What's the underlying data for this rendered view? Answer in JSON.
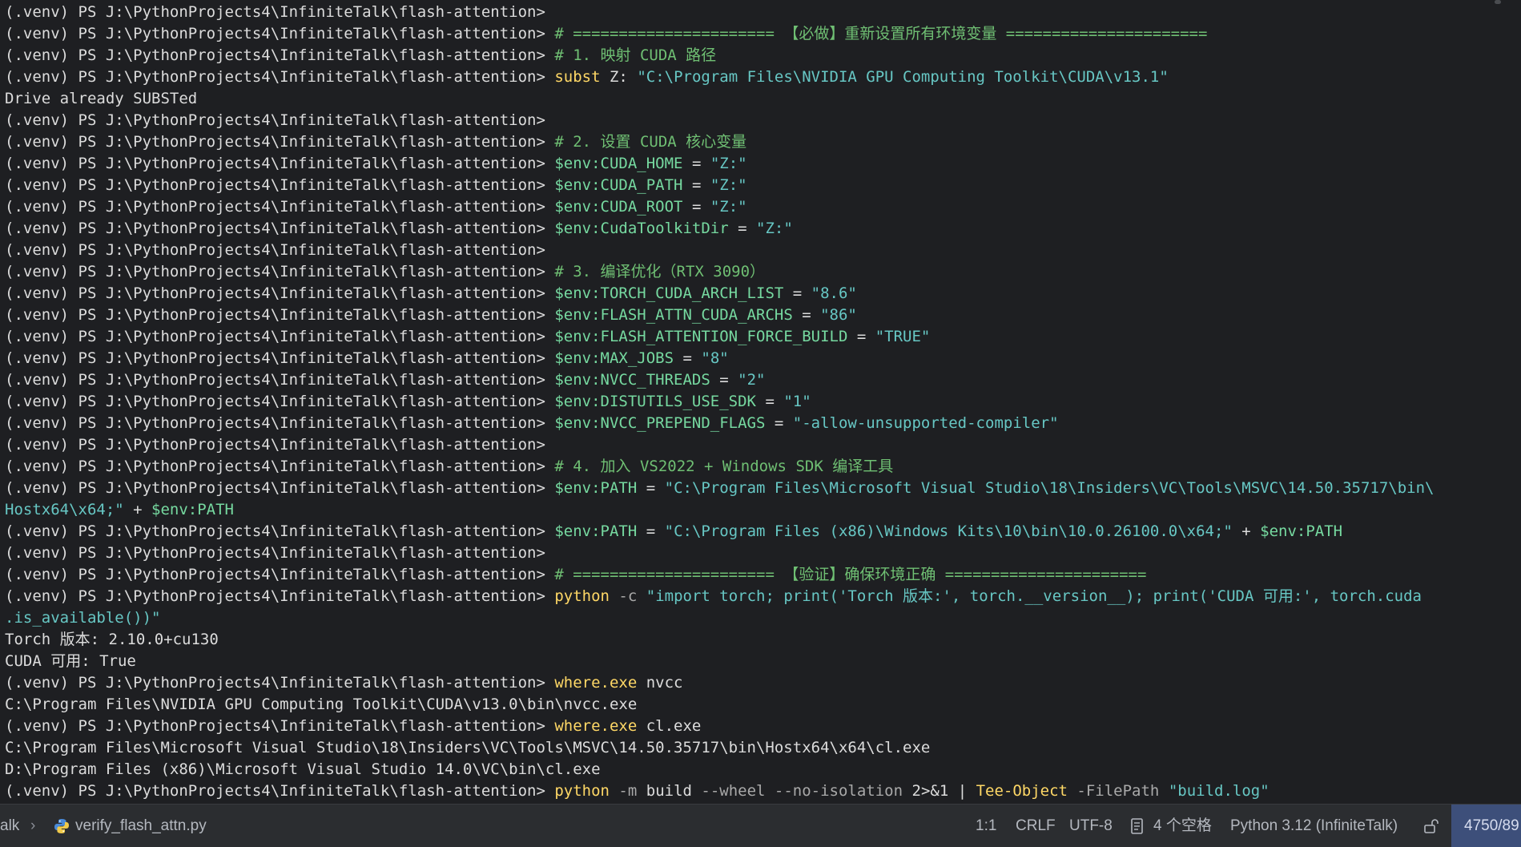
{
  "terminal": {
    "lines": [
      [
        {
          "t": "(.venv) PS J:\\PythonProjects4\\InfiniteTalk\\flash-attention> ",
          "c": "prompt"
        }
      ],
      [
        {
          "t": "(.venv) PS J:\\PythonProjects4\\InfiniteTalk\\flash-attention> ",
          "c": "prompt"
        },
        {
          "t": "# ====================== 【必做】重新设置所有环境变量 ======================",
          "c": "comment"
        }
      ],
      [
        {
          "t": "(.venv) PS J:\\PythonProjects4\\InfiniteTalk\\flash-attention> ",
          "c": "prompt"
        },
        {
          "t": "# 1. 映射 CUDA 路径",
          "c": "comment"
        }
      ],
      [
        {
          "t": "(.venv) PS J:\\PythonProjects4\\InfiniteTalk\\flash-attention> ",
          "c": "prompt"
        },
        {
          "t": "subst",
          "c": "cmd"
        },
        {
          "t": " Z: ",
          "c": "plain"
        },
        {
          "t": "\"C:\\Program Files\\NVIDIA GPU Computing Toolkit\\CUDA\\v13.1\"",
          "c": "str"
        }
      ],
      [
        {
          "t": "Drive already SUBSTed",
          "c": "out"
        }
      ],
      [
        {
          "t": "(.venv) PS J:\\PythonProjects4\\InfiniteTalk\\flash-attention> ",
          "c": "prompt"
        }
      ],
      [
        {
          "t": "(.venv) PS J:\\PythonProjects4\\InfiniteTalk\\flash-attention> ",
          "c": "prompt"
        },
        {
          "t": "# 2. 设置 CUDA 核心变量",
          "c": "comment"
        }
      ],
      [
        {
          "t": "(.venv) PS J:\\PythonProjects4\\InfiniteTalk\\flash-attention> ",
          "c": "prompt"
        },
        {
          "t": "$env:CUDA_HOME",
          "c": "var"
        },
        {
          "t": " = ",
          "c": "op"
        },
        {
          "t": "\"Z:\"",
          "c": "str"
        }
      ],
      [
        {
          "t": "(.venv) PS J:\\PythonProjects4\\InfiniteTalk\\flash-attention> ",
          "c": "prompt"
        },
        {
          "t": "$env:CUDA_PATH",
          "c": "var"
        },
        {
          "t": " = ",
          "c": "op"
        },
        {
          "t": "\"Z:\"",
          "c": "str"
        }
      ],
      [
        {
          "t": "(.venv) PS J:\\PythonProjects4\\InfiniteTalk\\flash-attention> ",
          "c": "prompt"
        },
        {
          "t": "$env:CUDA_ROOT",
          "c": "var"
        },
        {
          "t": " = ",
          "c": "op"
        },
        {
          "t": "\"Z:\"",
          "c": "str"
        }
      ],
      [
        {
          "t": "(.venv) PS J:\\PythonProjects4\\InfiniteTalk\\flash-attention> ",
          "c": "prompt"
        },
        {
          "t": "$env:CudaToolkitDir",
          "c": "var"
        },
        {
          "t": " = ",
          "c": "op"
        },
        {
          "t": "\"Z:\"",
          "c": "str"
        }
      ],
      [
        {
          "t": "(.venv) PS J:\\PythonProjects4\\InfiniteTalk\\flash-attention> ",
          "c": "prompt"
        }
      ],
      [
        {
          "t": "(.venv) PS J:\\PythonProjects4\\InfiniteTalk\\flash-attention> ",
          "c": "prompt"
        },
        {
          "t": "# 3. 编译优化（RTX 3090）",
          "c": "comment"
        }
      ],
      [
        {
          "t": "(.venv) PS J:\\PythonProjects4\\InfiniteTalk\\flash-attention> ",
          "c": "prompt"
        },
        {
          "t": "$env:TORCH_CUDA_ARCH_LIST",
          "c": "var"
        },
        {
          "t": " = ",
          "c": "op"
        },
        {
          "t": "\"8.6\"",
          "c": "str"
        }
      ],
      [
        {
          "t": "(.venv) PS J:\\PythonProjects4\\InfiniteTalk\\flash-attention> ",
          "c": "prompt"
        },
        {
          "t": "$env:FLASH_ATTN_CUDA_ARCHS",
          "c": "var"
        },
        {
          "t": " = ",
          "c": "op"
        },
        {
          "t": "\"86\"",
          "c": "str"
        }
      ],
      [
        {
          "t": "(.venv) PS J:\\PythonProjects4\\InfiniteTalk\\flash-attention> ",
          "c": "prompt"
        },
        {
          "t": "$env:FLASH_ATTENTION_FORCE_BUILD",
          "c": "var"
        },
        {
          "t": " = ",
          "c": "op"
        },
        {
          "t": "\"TRUE\"",
          "c": "str"
        }
      ],
      [
        {
          "t": "(.venv) PS J:\\PythonProjects4\\InfiniteTalk\\flash-attention> ",
          "c": "prompt"
        },
        {
          "t": "$env:MAX_JOBS",
          "c": "var"
        },
        {
          "t": " = ",
          "c": "op"
        },
        {
          "t": "\"8\"",
          "c": "str"
        }
      ],
      [
        {
          "t": "(.venv) PS J:\\PythonProjects4\\InfiniteTalk\\flash-attention> ",
          "c": "prompt"
        },
        {
          "t": "$env:NVCC_THREADS",
          "c": "var"
        },
        {
          "t": " = ",
          "c": "op"
        },
        {
          "t": "\"2\"",
          "c": "str"
        }
      ],
      [
        {
          "t": "(.venv) PS J:\\PythonProjects4\\InfiniteTalk\\flash-attention> ",
          "c": "prompt"
        },
        {
          "t": "$env:DISTUTILS_USE_SDK",
          "c": "var"
        },
        {
          "t": " = ",
          "c": "op"
        },
        {
          "t": "\"1\"",
          "c": "str"
        }
      ],
      [
        {
          "t": "(.venv) PS J:\\PythonProjects4\\InfiniteTalk\\flash-attention> ",
          "c": "prompt"
        },
        {
          "t": "$env:NVCC_PREPEND_FLAGS",
          "c": "var"
        },
        {
          "t": " = ",
          "c": "op"
        },
        {
          "t": "\"-allow-unsupported-compiler\"",
          "c": "str"
        }
      ],
      [
        {
          "t": "(.venv) PS J:\\PythonProjects4\\InfiniteTalk\\flash-attention> ",
          "c": "prompt"
        }
      ],
      [
        {
          "t": "(.venv) PS J:\\PythonProjects4\\InfiniteTalk\\flash-attention> ",
          "c": "prompt"
        },
        {
          "t": "# 4. 加入 VS2022 + Windows SDK 编译工具",
          "c": "comment"
        }
      ],
      [
        {
          "t": "(.venv) PS J:\\PythonProjects4\\InfiniteTalk\\flash-attention> ",
          "c": "prompt"
        },
        {
          "t": "$env:PATH",
          "c": "var"
        },
        {
          "t": " = ",
          "c": "op"
        },
        {
          "t": "\"C:\\Program Files\\Microsoft Visual Studio\\18\\Insiders\\VC\\Tools\\MSVC\\14.50.35717\\bin\\",
          "c": "str"
        }
      ],
      [
        {
          "t": "Hostx64\\x64;\"",
          "c": "str"
        },
        {
          "t": " + ",
          "c": "op"
        },
        {
          "t": "$env:PATH",
          "c": "var"
        }
      ],
      [
        {
          "t": "(.venv) PS J:\\PythonProjects4\\InfiniteTalk\\flash-attention> ",
          "c": "prompt"
        },
        {
          "t": "$env:PATH",
          "c": "var"
        },
        {
          "t": " = ",
          "c": "op"
        },
        {
          "t": "\"C:\\Program Files (x86)\\Windows Kits\\10\\bin\\10.0.26100.0\\x64;\"",
          "c": "str"
        },
        {
          "t": " + ",
          "c": "op"
        },
        {
          "t": "$env:PATH",
          "c": "var"
        }
      ],
      [
        {
          "t": "(.venv) PS J:\\PythonProjects4\\InfiniteTalk\\flash-attention> ",
          "c": "prompt"
        }
      ],
      [
        {
          "t": "(.venv) PS J:\\PythonProjects4\\InfiniteTalk\\flash-attention> ",
          "c": "prompt"
        },
        {
          "t": "# ====================== 【验证】确保环境正确 ======================",
          "c": "comment"
        }
      ],
      [
        {
          "t": "(.venv) PS J:\\PythonProjects4\\InfiniteTalk\\flash-attention> ",
          "c": "prompt"
        },
        {
          "t": "python",
          "c": "cmd"
        },
        {
          "t": " -c ",
          "c": "param"
        },
        {
          "t": "\"import torch; print('Torch 版本:', torch.__version__); print('CUDA 可用:', torch.cuda",
          "c": "str"
        }
      ],
      [
        {
          "t": ".is_available())\"",
          "c": "str"
        }
      ],
      [
        {
          "t": "Torch 版本: 2.10.0+cu130",
          "c": "out"
        }
      ],
      [
        {
          "t": "CUDA 可用: True",
          "c": "out"
        }
      ],
      [
        {
          "t": "(.venv) PS J:\\PythonProjects4\\InfiniteTalk\\flash-attention> ",
          "c": "prompt"
        },
        {
          "t": "where.exe",
          "c": "cmd"
        },
        {
          "t": " nvcc",
          "c": "plain"
        }
      ],
      [
        {
          "t": "C:\\Program Files\\NVIDIA GPU Computing Toolkit\\CUDA\\v13.0\\bin\\nvcc.exe",
          "c": "out"
        }
      ],
      [
        {
          "t": "(.venv) PS J:\\PythonProjects4\\InfiniteTalk\\flash-attention> ",
          "c": "prompt"
        },
        {
          "t": "where.exe",
          "c": "cmd"
        },
        {
          "t": " cl.exe",
          "c": "plain"
        }
      ],
      [
        {
          "t": "C:\\Program Files\\Microsoft Visual Studio\\18\\Insiders\\VC\\Tools\\MSVC\\14.50.35717\\bin\\Hostx64\\x64\\cl.exe",
          "c": "out"
        }
      ],
      [
        {
          "t": "D:\\Program Files (x86)\\Microsoft Visual Studio 14.0\\VC\\bin\\cl.exe",
          "c": "out"
        }
      ],
      [
        {
          "t": "(.venv) PS J:\\PythonProjects4\\InfiniteTalk\\flash-attention> ",
          "c": "prompt"
        },
        {
          "t": "python",
          "c": "cmd"
        },
        {
          "t": " -m ",
          "c": "param"
        },
        {
          "t": "build",
          "c": "plain"
        },
        {
          "t": " --wheel --no-isolation ",
          "c": "param"
        },
        {
          "t": "2>&1 ",
          "c": "plain"
        },
        {
          "t": "| ",
          "c": "op"
        },
        {
          "t": "Tee-Object",
          "c": "cmd"
        },
        {
          "t": " -FilePath ",
          "c": "param"
        },
        {
          "t": "\"build.log\"",
          "c": "str"
        }
      ]
    ]
  },
  "statusbar": {
    "breadcrumb_project": "alk",
    "breadcrumb_separator": "›",
    "file_icon": "python-icon",
    "file_name": "verify_flash_attn.py",
    "cursor_position": "1:1",
    "line_separator": "CRLF",
    "encoding": "UTF-8",
    "indent_icon": "document-icon",
    "indent": "4 个空格",
    "interpreter": "Python 3.12 (InfiniteTalk)",
    "lock_icon": "unlock-icon",
    "memory": "4750/89"
  },
  "colors": {
    "background": "#1e1f22",
    "statusbar": "#2b2d30",
    "comment": "#6fbf73",
    "command": "#ffd866",
    "variable": "#76d9a0",
    "string": "#67c7c4",
    "memory_highlight": "#3d4f7a"
  }
}
